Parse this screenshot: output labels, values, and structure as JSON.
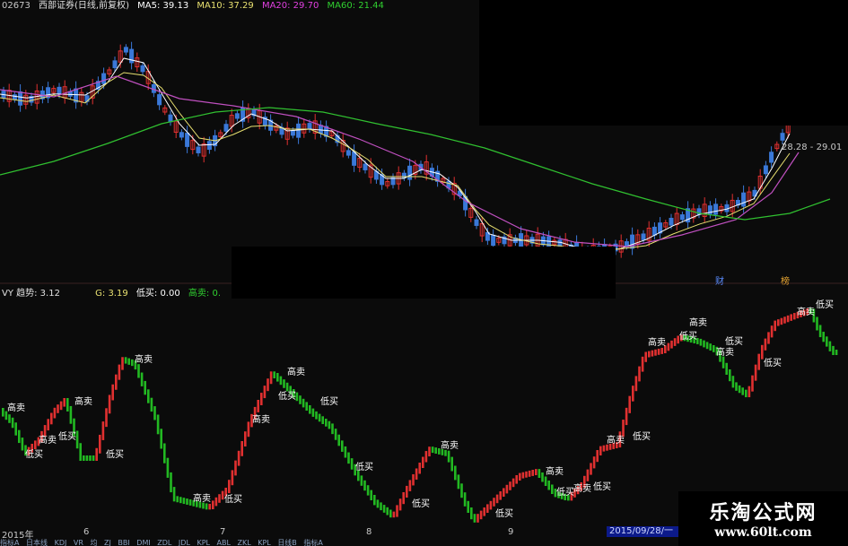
{
  "top_header": {
    "code": "02673",
    "name": "西部证券(日线,前复权)",
    "ma5": "MA5: 39.13",
    "ma10": "MA10: 37.29",
    "ma20": "MA20: 29.70",
    "ma60": "MA60: 21.44"
  },
  "indicator_header": {
    "trend": "VY 趋势: 3.12",
    "g": "G: 3.19",
    "low_buy": "低买: 0.00",
    "high_sell": "高卖: 0."
  },
  "price_label": "28.28 - 29.01",
  "financial_tags": [
    "财",
    "榜"
  ],
  "x_axis": [
    "2015年",
    "6",
    "7",
    "8",
    "9"
  ],
  "date_badge": "2015/09/28/一",
  "bottom_tabs": [
    "指标A",
    "日本线",
    "KDJ",
    "VR",
    "均",
    "ZJ",
    "BBI",
    "DMI",
    "ZDL",
    "JDL",
    "KPL",
    "ABL",
    "ZKL",
    "KPL",
    "日线B",
    "指标A"
  ],
  "signal_labels": {
    "buy": "低买",
    "sell": "高卖"
  },
  "watermark": {
    "name": "乐淘公式网",
    "url": "www.60lt.com"
  },
  "colors": {
    "up": "#e03030",
    "down": "#22b822",
    "ma5": "#ffffff",
    "ma10": "#e8e070",
    "ma20": "#c050c0",
    "ma60": "#30c030",
    "signal_buy": "#ffffff",
    "signal_sell": "#ffffff"
  },
  "chart_data": [
    {
      "type": "candlestick",
      "title": "西部证券(日线,前复权)",
      "series_names": [
        "MA5",
        "MA10",
        "MA20",
        "MA60"
      ]
    },
    {
      "type": "bar",
      "title": "趋势",
      "series_names": [
        "趋势",
        "G",
        "低买",
        "高卖"
      ]
    }
  ]
}
